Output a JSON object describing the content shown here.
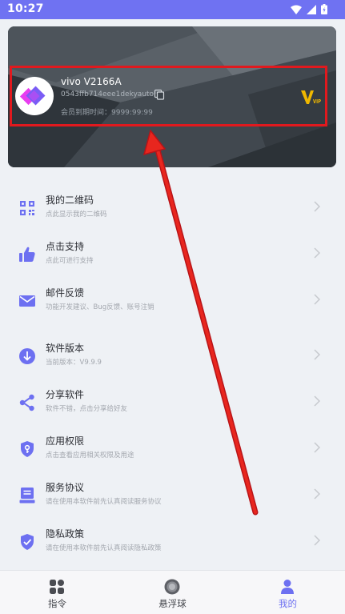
{
  "status_bar": {
    "time": "10:27"
  },
  "profile": {
    "device_name": "vivo V2166A",
    "device_id": "0543ffb714eee1dekyauto",
    "expire": "会员到期时间：9999:99:99",
    "vip_label": "VIP"
  },
  "menu": [
    {
      "title": "我的二维码",
      "subtitle": "点此显示我的二维码",
      "icon": "qrcode-icon"
    },
    {
      "title": "点击支持",
      "subtitle": "点此可进行支持",
      "icon": "thumbs-up-icon"
    },
    {
      "title": "邮件反馈",
      "subtitle": "功能开发建议、Bug反馈、账号注销",
      "icon": "mail-icon"
    },
    {
      "title": "软件版本",
      "subtitle": "当前版本：V9.9.9",
      "icon": "download-icon"
    },
    {
      "title": "分享软件",
      "subtitle": "软件不错，点击分享给好友",
      "icon": "share-icon"
    },
    {
      "title": "应用权限",
      "subtitle": "点击查看应用相关权限及用途",
      "icon": "shield-key-icon"
    },
    {
      "title": "服务协议",
      "subtitle": "请在使用本软件前先认真阅读服务协议",
      "icon": "document-icon"
    },
    {
      "title": "隐私政策",
      "subtitle": "请在使用本软件前先认真阅读隐私政策",
      "icon": "privacy-shield-icon"
    }
  ],
  "bottom_nav": {
    "tabs": [
      {
        "label": "指令",
        "icon": "grid-icon"
      },
      {
        "label": "悬浮球",
        "icon": "ball-icon"
      },
      {
        "label": "我的",
        "icon": "person-icon",
        "active": true
      }
    ]
  },
  "colors": {
    "accent": "#6d70f1",
    "status_bar": "#6f72f2",
    "highlight": "#e1191e"
  }
}
